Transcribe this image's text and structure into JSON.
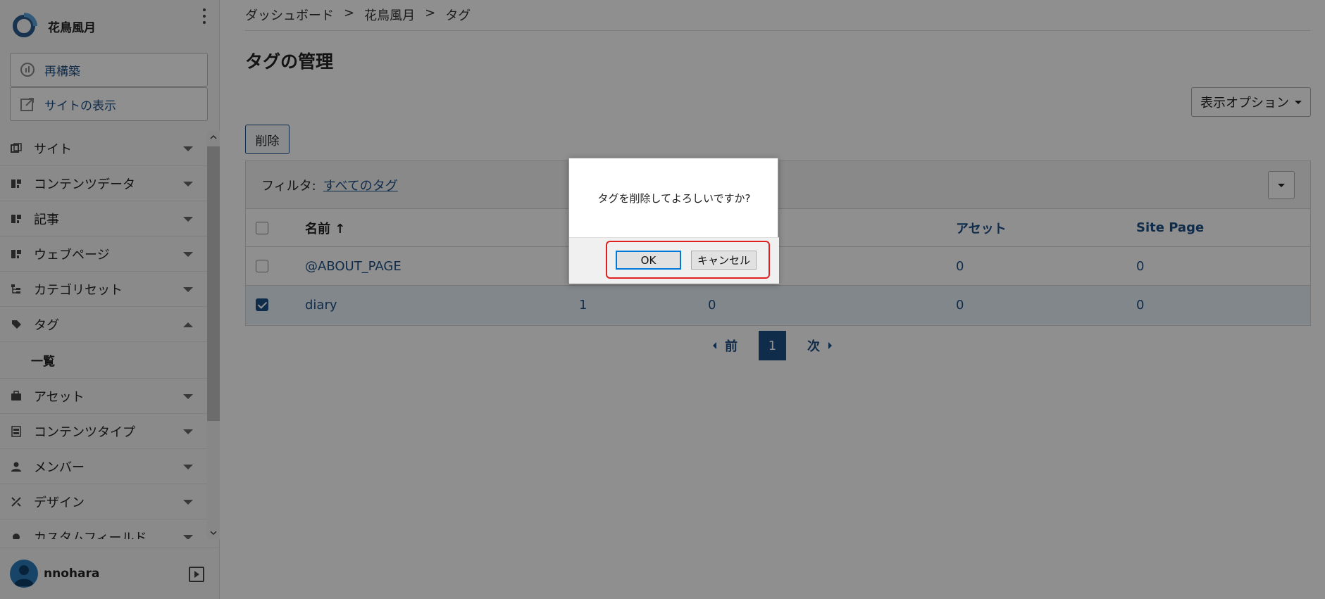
{
  "sidebar": {
    "brand_name": "花鳥風月",
    "rebuild_label": "再構築",
    "view_site_label": "サイトの表示",
    "items": [
      {
        "label": "サイト",
        "icon": "site-icon",
        "expanded": false
      },
      {
        "label": "コンテンツデータ",
        "icon": "content-data-icon",
        "expanded": false
      },
      {
        "label": "記事",
        "icon": "entry-icon",
        "expanded": false
      },
      {
        "label": "ウェブページ",
        "icon": "webpage-icon",
        "expanded": false
      },
      {
        "label": "カテゴリセット",
        "icon": "category-set-icon",
        "expanded": false
      },
      {
        "label": "タグ",
        "icon": "tag-icon",
        "expanded": true
      },
      {
        "label": "アセット",
        "icon": "asset-icon",
        "expanded": false
      },
      {
        "label": "コンテンツタイプ",
        "icon": "content-type-icon",
        "expanded": false
      },
      {
        "label": "メンバー",
        "icon": "member-icon",
        "expanded": false
      },
      {
        "label": "デザイン",
        "icon": "design-icon",
        "expanded": false
      },
      {
        "label": "カスタムフィールド",
        "icon": "custom-field-icon",
        "expanded": false
      }
    ],
    "tag_sub": {
      "list_label": "一覧"
    },
    "user_name": "nnohara"
  },
  "breadcrumb": {
    "items": [
      "ダッシュボード",
      "花鳥風月",
      "タグ"
    ],
    "separator": ">"
  },
  "page_title": "タグの管理",
  "display_options_label": "表示オプション",
  "delete_button_label": "削除",
  "filter": {
    "label": "フィルタ:",
    "value": "すべてのタグ"
  },
  "table": {
    "headers": {
      "name": "名前",
      "sort_arrow": "↑",
      "asset": "アセット",
      "site_page": "Site Page"
    },
    "rows": [
      {
        "name": "@ABOUT_PAGE",
        "col2": "",
        "col3": "",
        "asset": "0",
        "site_page": "0",
        "checked": false
      },
      {
        "name": "diary",
        "col2": "1",
        "col3": "0",
        "asset": "0",
        "site_page": "0",
        "checked": true
      }
    ]
  },
  "pagination": {
    "prev_label": "前",
    "current": "1",
    "next_label": "次"
  },
  "dialog": {
    "message": "タグを削除してよろしいですか?",
    "ok_label": "OK",
    "cancel_label": "キャンセル"
  },
  "colors": {
    "accent": "#1d4f86",
    "highlight": "#e02020",
    "overlay": "rgba(0,0,0,0.44)"
  }
}
